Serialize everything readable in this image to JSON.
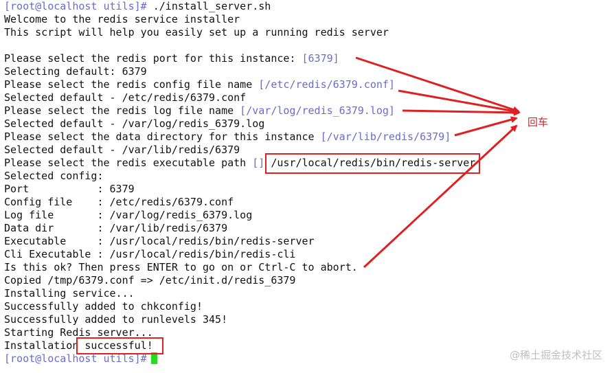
{
  "terminal": {
    "prompt": "[root@localhost utils]#",
    "command": " ./install_server.sh",
    "lines": {
      "welcome": "Welcome to the redis service installer",
      "intro": "This script will help you easily set up a running redis server",
      "port_q": "Please select the redis port for this instance: ",
      "port_default": "[6379]",
      "port_sel": "Selecting default: 6379",
      "conf_q": "Please select the redis config file name ",
      "conf_default": "[/etc/redis/6379.conf]",
      "conf_sel": "Selected default - /etc/redis/6379.conf",
      "log_q": "Please select the redis log file name ",
      "log_default": "[/var/log/redis_6379.log]",
      "log_sel": "Selected default - /var/log/redis_6379.log",
      "data_q": "Please select the data directory for this instance ",
      "data_default": "[/var/lib/redis/6379]",
      "data_sel": "Selected default - /var/lib/redis/6379",
      "exec_q": "Please select the redis executable path ",
      "exec_default": "[]",
      "exec_input": " /usr/local/redis/bin/redis-server",
      "config_header": "Selected config:",
      "cfg_port": "Port           : 6379",
      "cfg_conf": "Config file    : /etc/redis/6379.conf",
      "cfg_log": "Log file       : /var/log/redis_6379.log",
      "cfg_data": "Data dir       : /var/lib/redis/6379",
      "cfg_exec": "Executable     : /usr/local/redis/bin/redis-server",
      "cfg_cli": "Cli Executable : /usr/local/redis/bin/redis-cli",
      "confirm": "Is this ok? Then press ENTER to go on or Ctrl-C to abort.",
      "copied": "Copied /tmp/6379.conf => /etc/init.d/redis_6379",
      "installing": "Installing service...",
      "chkconfig": "Successfully added to chkconfig!",
      "runlevels": "Successfully added to runlevels 345!",
      "starting": "Starting Redis server...",
      "install_prefix": "Installation",
      "install_result": " successful!"
    },
    "final_prompt": "[root@localhost utils]#"
  },
  "annotation": {
    "label": "回车",
    "color": "#e02020"
  },
  "watermark": "@稀土掘金技术社区",
  "colors": {
    "prompt": "#6a6ad0",
    "text": "#111111",
    "cursor": "#22dd22",
    "highlight_box": "#e02020"
  }
}
